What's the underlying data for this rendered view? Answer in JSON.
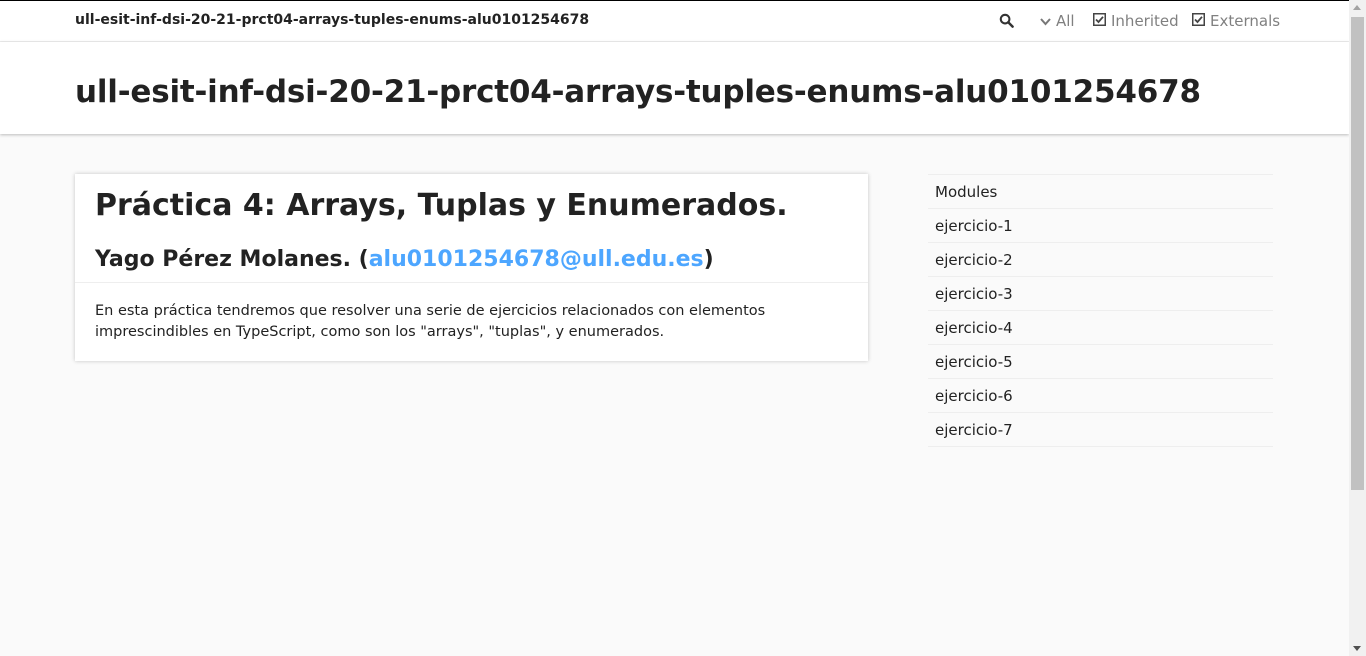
{
  "header": {
    "brand": "ull-esit-inf-dsi-20-21-prct04-arrays-tuples-enums-alu0101254678",
    "search_icon": "search-icon",
    "settings": [
      {
        "label": "All",
        "icon": "chevron-down-icon"
      },
      {
        "label": "Inherited",
        "icon": "checkbox-checked-icon"
      },
      {
        "label": "Externals",
        "icon": "checkbox-checked-icon"
      }
    ]
  },
  "title": "ull-esit-inf-dsi-20-21-prct04-arrays-tuples-enums-alu0101254678",
  "content": {
    "heading": "Práctica 4: Arrays, Tuplas y Enumerados.",
    "author_prefix": "Yago Pérez Molanes. (",
    "author_email": "alu0101254678@ull.edu.es",
    "author_suffix": ")",
    "description": "En esta práctica tendremos que resolver una serie de ejercicios relacionados con elementos imprescindibles en TypeScript, como son los \"arrays\", \"tuplas\", y enumerados."
  },
  "nav": {
    "items": [
      "Modules",
      "ejercicio-1",
      "ejercicio-2",
      "ejercicio-3",
      "ejercicio-4",
      "ejercicio-5",
      "ejercicio-6",
      "ejercicio-7"
    ]
  },
  "colors": {
    "link": "#4da6ff",
    "muted": "#808080"
  }
}
